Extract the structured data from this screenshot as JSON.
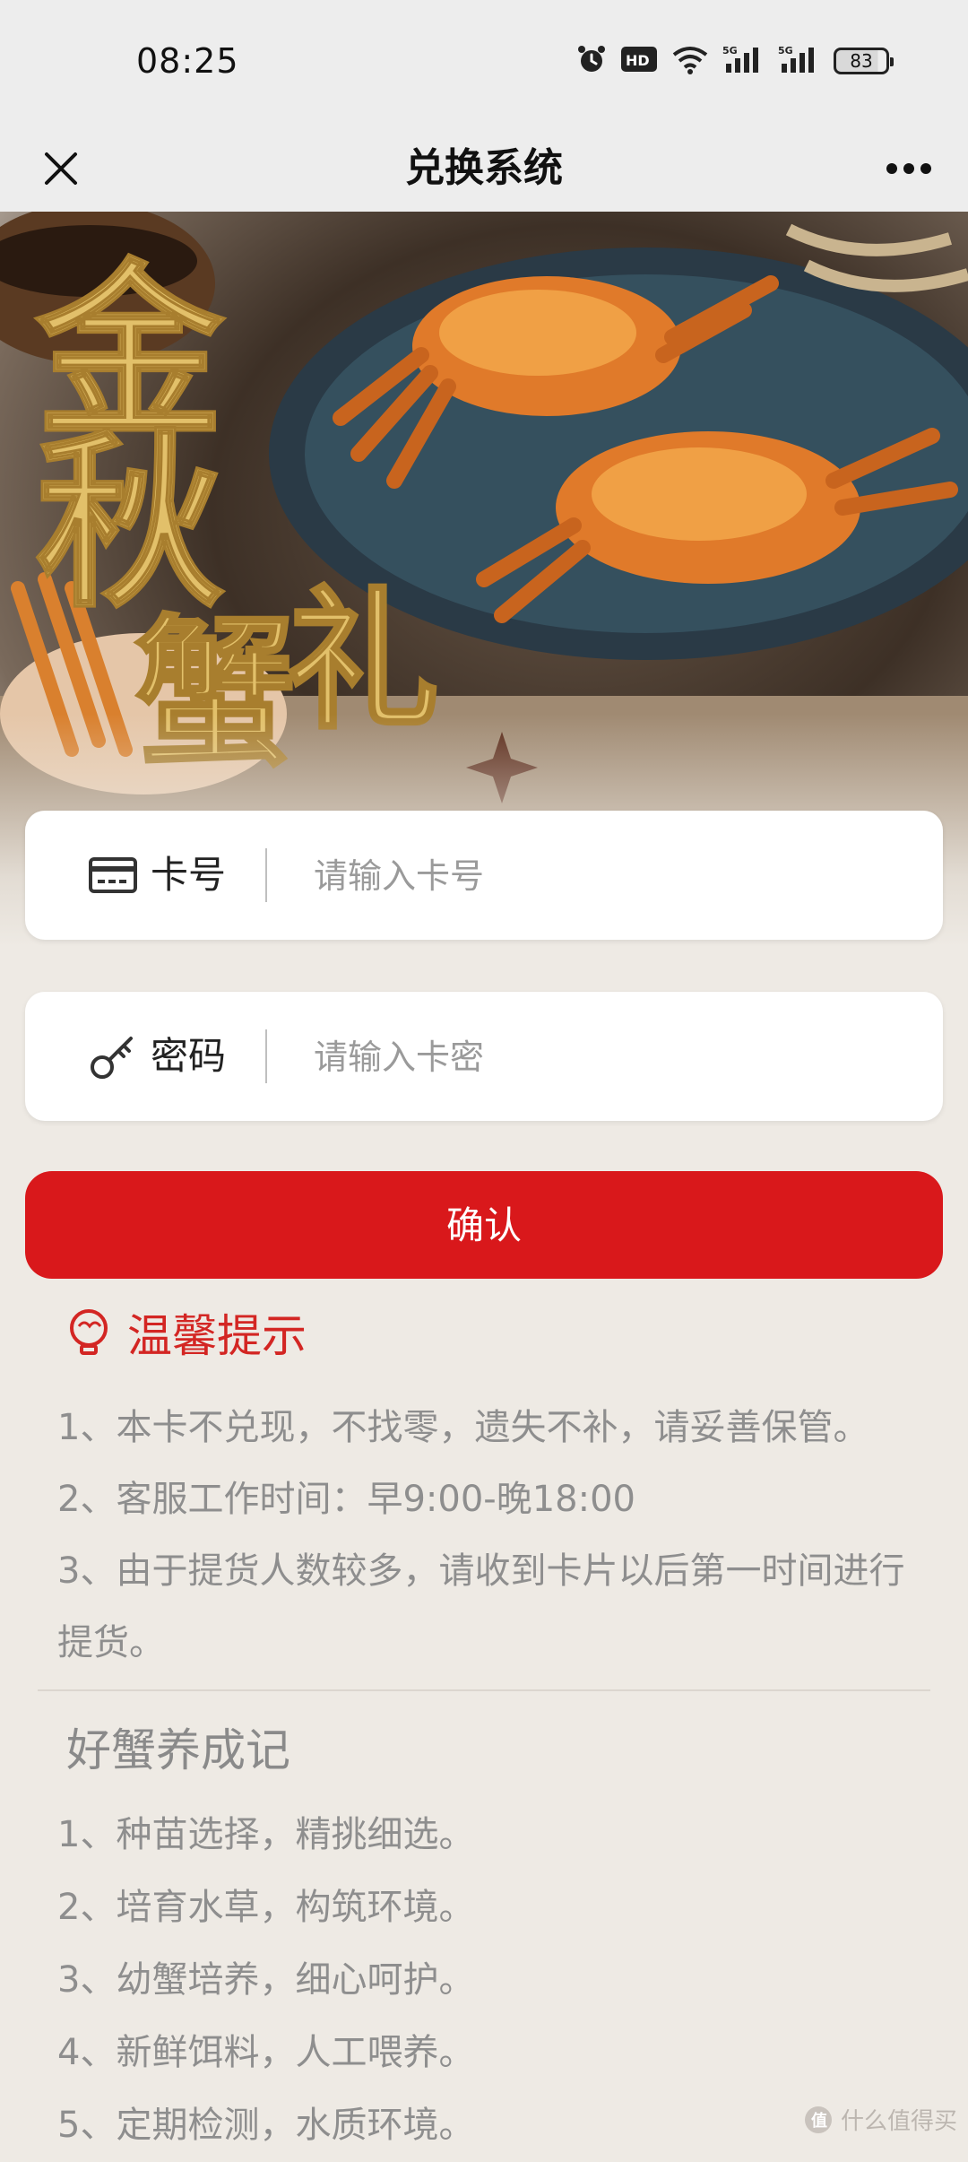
{
  "status_bar": {
    "time": "08:25",
    "battery": "83",
    "icons": [
      "alarm-icon",
      "hd-icon",
      "wifi-icon",
      "5g-signal-icon",
      "5g-signal-icon",
      "battery-icon"
    ]
  },
  "nav": {
    "title": "兑换系统",
    "close_icon": "close-icon",
    "more_icon": "more-icon"
  },
  "banner": {
    "calligraphy": "金秋蟹礼"
  },
  "form": {
    "card_number": {
      "label": "卡号",
      "placeholder": "请输入卡号",
      "value": "",
      "icon": "card-icon"
    },
    "password": {
      "label": "密码",
      "placeholder": "请输入卡密",
      "value": "",
      "icon": "key-icon"
    },
    "confirm_label": "确认"
  },
  "tips": {
    "title": "温馨提示",
    "items": [
      "1、本卡不兑现，不找零，遗失不补，请妥善保管。",
      "2、客服工作时间：早9:00-晚18:00",
      "3、由于提货人数较多，请收到卡片以后第一时间进行提货。"
    ]
  },
  "care": {
    "title": "好蟹养成记",
    "items": [
      "1、种苗选择，精挑细选。",
      "2、培育水草，构筑环境。",
      "3、幼蟹培养，细心呵护。",
      "4、新鲜饵料，人工喂养。",
      "5、定期检测，水质环境。"
    ]
  },
  "watermark": "什么值得买",
  "colors": {
    "accent": "#d9181b",
    "tip_title": "#d32623",
    "text_muted": "#8e8e8e",
    "page_bg": "#eeeae4"
  }
}
